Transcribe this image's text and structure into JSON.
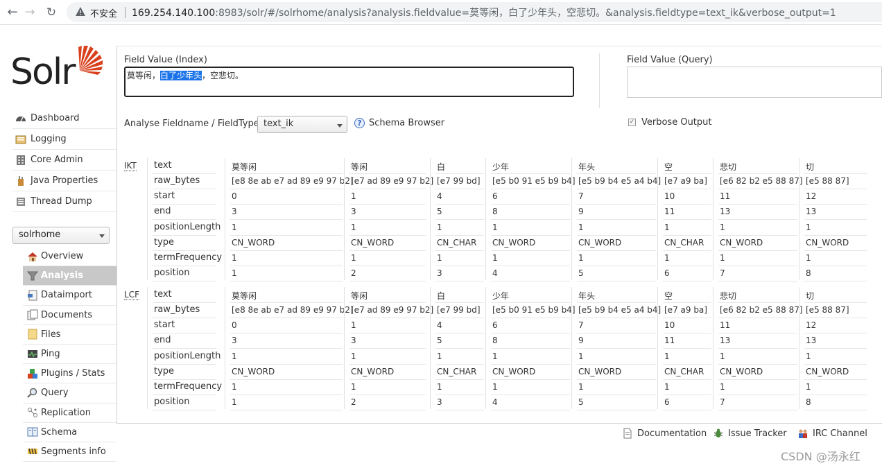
{
  "browser": {
    "back": "←",
    "forward": "→",
    "reload": "↻",
    "insecure": "不安全",
    "url_host": "169.254.140.100",
    "url_path": ":8983/solr/#/solrhome/analysis?analysis.fieldvalue=莫等闲，白了少年头，空悲切。&analysis.fieldtype=text_ik&verbose_output=1"
  },
  "logo": {
    "text": "Solr"
  },
  "main_nav": [
    {
      "label": "Dashboard",
      "icon": "dashboard-icon"
    },
    {
      "label": "Logging",
      "icon": "logging-icon"
    },
    {
      "label": "Core Admin",
      "icon": "core-admin-icon"
    },
    {
      "label": "Java Properties",
      "icon": "java-icon"
    },
    {
      "label": "Thread Dump",
      "icon": "thread-dump-icon"
    }
  ],
  "core_selector": {
    "value": "solrhome"
  },
  "core_nav": [
    {
      "label": "Overview",
      "icon": "home-icon"
    },
    {
      "label": "Analysis",
      "icon": "funnel-icon",
      "active": true
    },
    {
      "label": "Dataimport",
      "icon": "dataimport-icon"
    },
    {
      "label": "Documents",
      "icon": "documents-icon"
    },
    {
      "label": "Files",
      "icon": "folder-icon"
    },
    {
      "label": "Ping",
      "icon": "ping-icon"
    },
    {
      "label": "Plugins / Stats",
      "icon": "plugins-icon"
    },
    {
      "label": "Query",
      "icon": "magnifier-icon"
    },
    {
      "label": "Replication",
      "icon": "replication-icon"
    },
    {
      "label": "Schema",
      "icon": "schema-icon"
    },
    {
      "label": "Segments info",
      "icon": "segments-icon"
    }
  ],
  "analysis": {
    "field_value_index_label": "Field Value (Index)",
    "field_value_query_label": "Field Value (Query)",
    "index_value_before": "莫等闲，",
    "index_value_selected": "白了少年头",
    "index_value_after": "，空悲切。",
    "fieldtype_label": "Analyse Fieldname / FieldType:",
    "fieldtype_value": "text_ik",
    "schema_browser": "Schema Browser",
    "verbose_output": "Verbose Output"
  },
  "row_labels": [
    "text",
    "raw_bytes",
    "start",
    "end",
    "positionLength",
    "type",
    "termFrequency",
    "position"
  ],
  "stages": [
    {
      "name": "IKT",
      "tokens": [
        {
          "text": "莫等闲",
          "raw_bytes": "[e8 8e ab e7 ad 89 e9 97 b2]",
          "start": "0",
          "end": "3",
          "positionLength": "1",
          "type": "CN_WORD",
          "termFrequency": "1",
          "position": "1"
        },
        {
          "text": "等闲",
          "raw_bytes": "[e7 ad 89 e9 97 b2]",
          "start": "1",
          "end": "3",
          "positionLength": "1",
          "type": "CN_WORD",
          "termFrequency": "1",
          "position": "2"
        },
        {
          "text": "白",
          "raw_bytes": "[e7 99 bd]",
          "start": "4",
          "end": "5",
          "positionLength": "1",
          "type": "CN_CHAR",
          "termFrequency": "1",
          "position": "3"
        },
        {
          "text": "少年",
          "raw_bytes": "[e5 b0 91 e5 b9 b4]",
          "start": "6",
          "end": "8",
          "positionLength": "1",
          "type": "CN_WORD",
          "termFrequency": "1",
          "position": "4"
        },
        {
          "text": "年头",
          "raw_bytes": "[e5 b9 b4 e5 a4 b4]",
          "start": "7",
          "end": "9",
          "positionLength": "1",
          "type": "CN_WORD",
          "termFrequency": "1",
          "position": "5"
        },
        {
          "text": "空",
          "raw_bytes": "[e7 a9 ba]",
          "start": "10",
          "end": "11",
          "positionLength": "1",
          "type": "CN_CHAR",
          "termFrequency": "1",
          "position": "6"
        },
        {
          "text": "悲切",
          "raw_bytes": "[e6 82 b2 e5 88 87]",
          "start": "11",
          "end": "13",
          "positionLength": "1",
          "type": "CN_WORD",
          "termFrequency": "1",
          "position": "7"
        },
        {
          "text": "切",
          "raw_bytes": "[e5 88 87]",
          "start": "12",
          "end": "13",
          "positionLength": "1",
          "type": "CN_WORD",
          "termFrequency": "1",
          "position": "8"
        }
      ]
    },
    {
      "name": "LCF",
      "tokens": [
        {
          "text": "莫等闲",
          "raw_bytes": "[e8 8e ab e7 ad 89 e9 97 b2]",
          "start": "0",
          "end": "3",
          "positionLength": "1",
          "type": "CN_WORD",
          "termFrequency": "1",
          "position": "1"
        },
        {
          "text": "等闲",
          "raw_bytes": "[e7 ad 89 e9 97 b2]",
          "start": "1",
          "end": "3",
          "positionLength": "1",
          "type": "CN_WORD",
          "termFrequency": "1",
          "position": "2"
        },
        {
          "text": "白",
          "raw_bytes": "[e7 99 bd]",
          "start": "4",
          "end": "5",
          "positionLength": "1",
          "type": "CN_CHAR",
          "termFrequency": "1",
          "position": "3"
        },
        {
          "text": "少年",
          "raw_bytes": "[e5 b0 91 e5 b9 b4]",
          "start": "6",
          "end": "8",
          "positionLength": "1",
          "type": "CN_WORD",
          "termFrequency": "1",
          "position": "4"
        },
        {
          "text": "年头",
          "raw_bytes": "[e5 b9 b4 e5 a4 b4]",
          "start": "7",
          "end": "9",
          "positionLength": "1",
          "type": "CN_WORD",
          "termFrequency": "1",
          "position": "5"
        },
        {
          "text": "空",
          "raw_bytes": "[e7 a9 ba]",
          "start": "10",
          "end": "11",
          "positionLength": "1",
          "type": "CN_CHAR",
          "termFrequency": "1",
          "position": "6"
        },
        {
          "text": "悲切",
          "raw_bytes": "[e6 82 b2 e5 88 87]",
          "start": "11",
          "end": "13",
          "positionLength": "1",
          "type": "CN_WORD",
          "termFrequency": "1",
          "position": "7"
        },
        {
          "text": "切",
          "raw_bytes": "[e5 88 87]",
          "start": "12",
          "end": "13",
          "positionLength": "1",
          "type": "CN_WORD",
          "termFrequency": "1",
          "position": "8"
        }
      ]
    }
  ],
  "footer": {
    "documentation": "Documentation",
    "issue_tracker": "Issue Tracker",
    "irc_channel": "IRC Channel"
  },
  "watermark": "CSDN @汤永红",
  "colors": {
    "selection": "#1a73e8",
    "logo_red": "#d9411e",
    "active_nav": "#c8c8c8"
  }
}
